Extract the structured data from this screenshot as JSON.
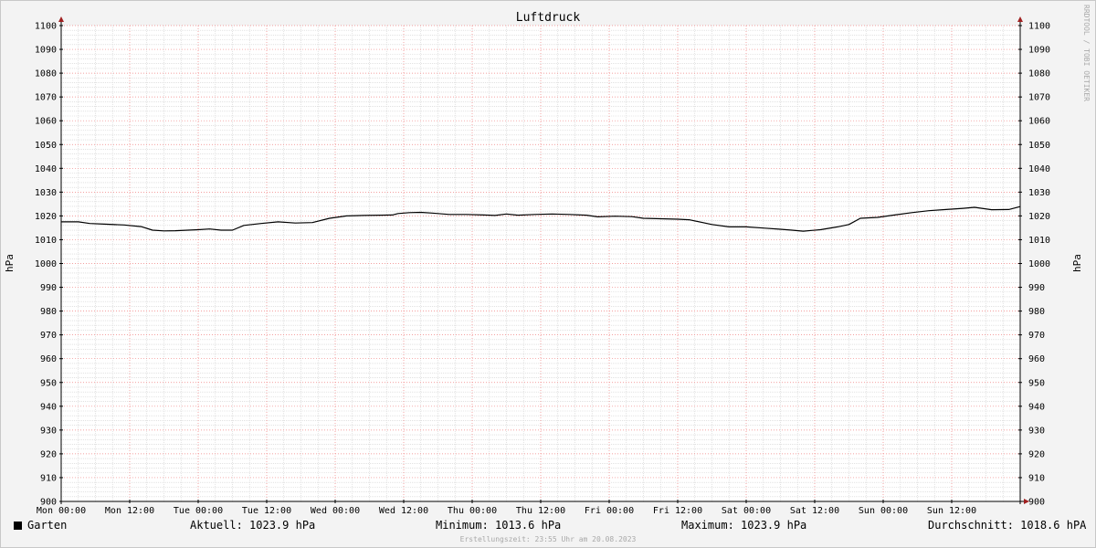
{
  "chart_data": {
    "type": "line",
    "title": "Luftdruck",
    "ylabel": "hPa",
    "ylabel_right": "hPa",
    "ylim": [
      900,
      1100
    ],
    "yticks": [
      900,
      910,
      920,
      930,
      940,
      950,
      960,
      970,
      980,
      990,
      1000,
      1010,
      1020,
      1030,
      1040,
      1050,
      1060,
      1070,
      1080,
      1090,
      1100
    ],
    "x_unit": "hours since Mon 00:00",
    "xlim": [
      0,
      168
    ],
    "xticks": [
      {
        "x": 0,
        "label": "Mon 00:00"
      },
      {
        "x": 12,
        "label": "Mon 12:00"
      },
      {
        "x": 24,
        "label": "Tue 00:00"
      },
      {
        "x": 36,
        "label": "Tue 12:00"
      },
      {
        "x": 48,
        "label": "Wed 00:00"
      },
      {
        "x": 60,
        "label": "Wed 12:00"
      },
      {
        "x": 72,
        "label": "Thu 00:00"
      },
      {
        "x": 84,
        "label": "Thu 12:00"
      },
      {
        "x": 96,
        "label": "Fri 00:00"
      },
      {
        "x": 108,
        "label": "Fri 12:00"
      },
      {
        "x": 120,
        "label": "Sat 00:00"
      },
      {
        "x": 132,
        "label": "Sat 12:00"
      },
      {
        "x": 144,
        "label": "Sun 00:00"
      },
      {
        "x": 156,
        "label": "Sun 12:00"
      }
    ],
    "grid": true,
    "series": [
      {
        "name": "Garten",
        "color": "#000000",
        "x": [
          0,
          3,
          5,
          8,
          11,
          14,
          16,
          18,
          20,
          24,
          26,
          28,
          30,
          32,
          35,
          38,
          41,
          44,
          47,
          50,
          53,
          56,
          58,
          59,
          61,
          63,
          65,
          68,
          71,
          74,
          76,
          78,
          80,
          83,
          86,
          89,
          92,
          94,
          97,
          100,
          102,
          105,
          108,
          110,
          114,
          117,
          120,
          123,
          126,
          128,
          130,
          133,
          136,
          138,
          140,
          143,
          146,
          149,
          152,
          155,
          158,
          160,
          163,
          166,
          168
        ],
        "y": [
          1017.5,
          1017.5,
          1016.8,
          1016.5,
          1016.2,
          1015.5,
          1014.0,
          1013.7,
          1013.8,
          1014.2,
          1014.5,
          1014.0,
          1014.0,
          1016.0,
          1016.8,
          1017.5,
          1017.0,
          1017.2,
          1019.0,
          1020.0,
          1020.2,
          1020.3,
          1020.4,
          1021.0,
          1021.4,
          1021.5,
          1021.2,
          1020.6,
          1020.6,
          1020.4,
          1020.2,
          1020.8,
          1020.3,
          1020.6,
          1020.8,
          1020.6,
          1020.3,
          1019.6,
          1019.9,
          1019.7,
          1019.0,
          1018.8,
          1018.6,
          1018.4,
          1016.4,
          1015.4,
          1015.4,
          1014.9,
          1014.4,
          1014.0,
          1013.6,
          1014.2,
          1015.4,
          1016.4,
          1019.0,
          1019.4,
          1020.4,
          1021.4,
          1022.2,
          1022.7,
          1023.2,
          1023.6,
          1022.6,
          1022.7,
          1023.9
        ]
      }
    ]
  },
  "legend": {
    "series_name": "Garten",
    "current": "Aktuell: 1023.9 hPa",
    "minimum": "Minimum: 1013.6 hPa",
    "maximum": "Maximum: 1023.9 hPa",
    "average": "Durchschnitt: 1018.6 hPA"
  },
  "footer": "Erstellungszeit: 23:55 Uhr am 20.08.2023",
  "watermark": "RRDTOOL / TOBI OETIKER",
  "colors": {
    "line": "#000000",
    "major_grid": "#f08080",
    "minor_grid": "#d0d0d0",
    "axis": "#000000",
    "arrow": "#a02020",
    "plot_background": "#ffffff",
    "canvas_background": "#f3f3f3"
  }
}
